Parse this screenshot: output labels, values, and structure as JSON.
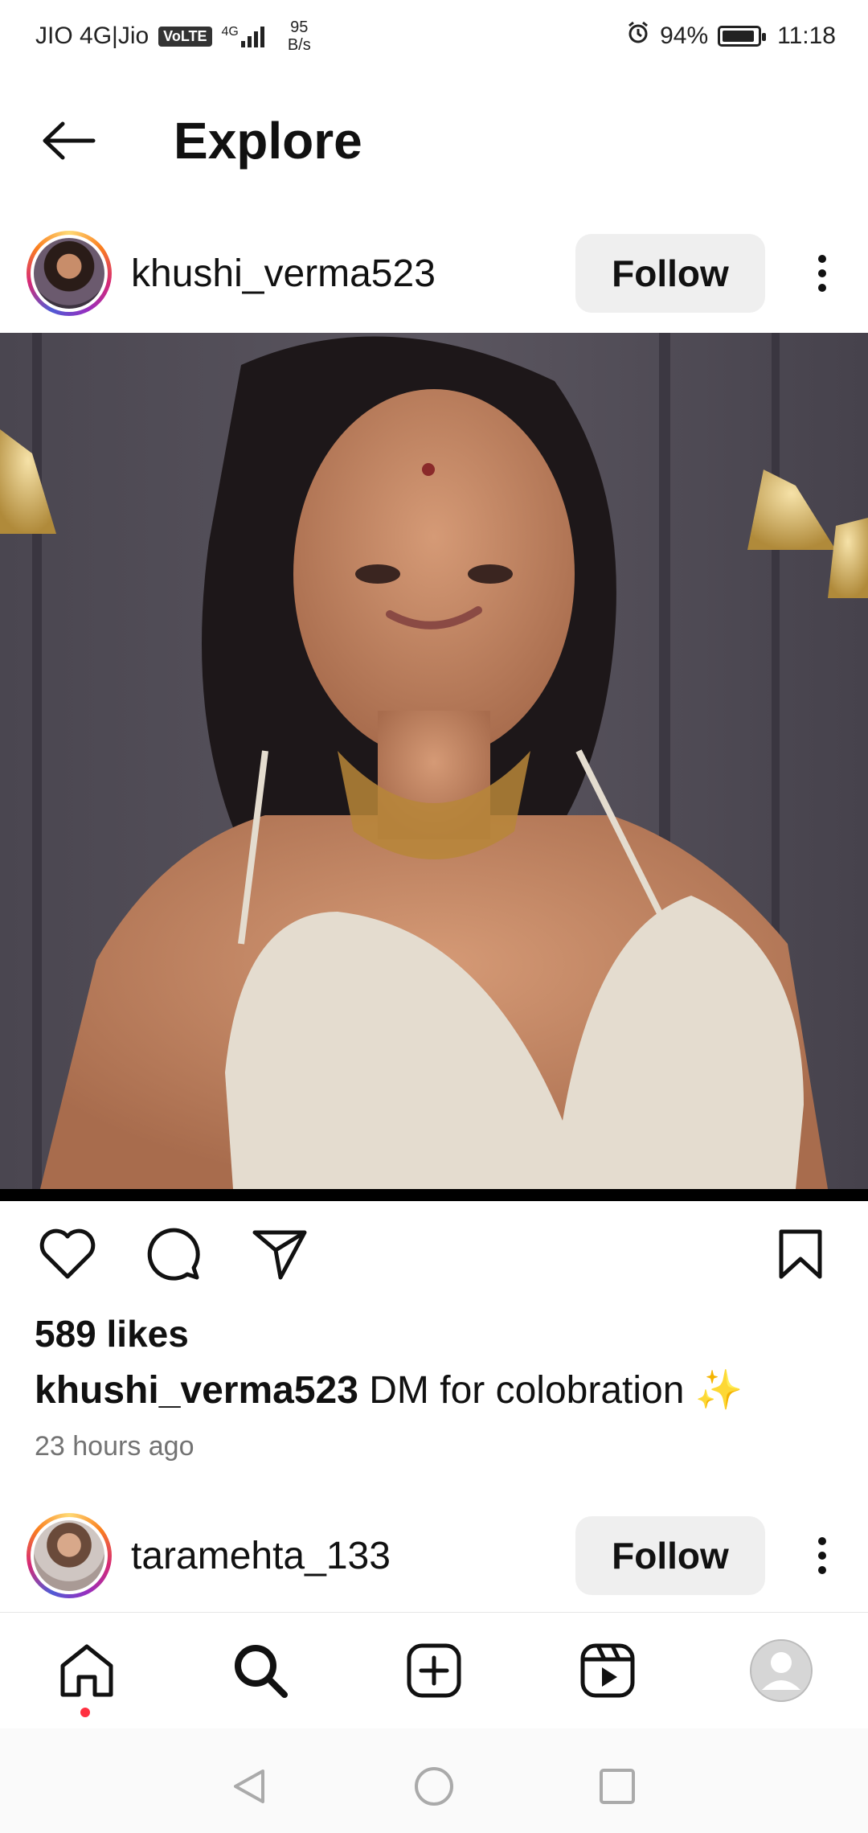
{
  "status_bar": {
    "carrier": "JIO 4G|Jio",
    "volte": "VoLTE",
    "network": "4G",
    "net_speed_value": "95",
    "net_speed_unit": "B/s",
    "battery_percent": "94%",
    "battery_level": 0.94,
    "time": "11:18"
  },
  "header": {
    "title": "Explore",
    "back_icon": "arrow-left-icon"
  },
  "posts": [
    {
      "username": "khushi_verma523",
      "follow_label": "Follow",
      "likes": "589 likes",
      "caption_user": "khushi_verma523",
      "caption_text": "DM for colobration ✨",
      "timestamp": "23 hours ago"
    },
    {
      "username": "taramehta_133",
      "follow_label": "Follow"
    }
  ],
  "colors": {
    "follow_bg": "#efefef",
    "accent_red": "#ff3040",
    "muted_text": "#737373"
  },
  "icons": {
    "like": "heart-icon",
    "comment": "comment-icon",
    "share": "send-icon",
    "save": "bookmark-icon",
    "more": "more-vertical-icon"
  },
  "bottom_nav": [
    "home-icon",
    "search-icon",
    "create-icon",
    "reels-icon",
    "profile-icon"
  ],
  "system_nav": [
    "back-triangle-icon",
    "home-circle-icon",
    "recents-square-icon"
  ]
}
